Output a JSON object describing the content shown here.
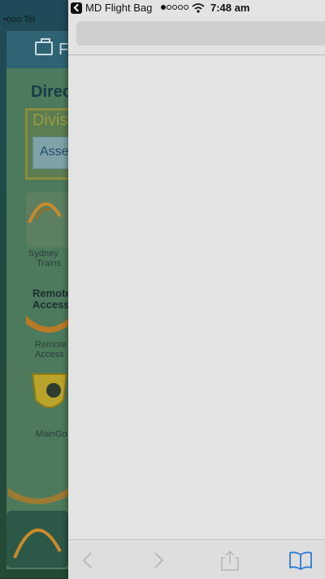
{
  "background_app": {
    "status_carrier": "•ooo Tel",
    "header_text": "F",
    "panel_title": "Direc",
    "division_label": "Divis",
    "division_button": "Asse",
    "tiles": [
      {
        "label_line1": "Sydney",
        "label_line2": "Trains"
      },
      {
        "label_line1": "Remote",
        "label_line2": "Access"
      },
      {
        "label_line1": "MainGo",
        "label_line2": ""
      }
    ],
    "section_label_line1": "Remote",
    "section_label_line2": "Access"
  },
  "status_bar": {
    "back_app_label": "MD Flight Bag",
    "signal_strength": 1,
    "signal_total": 5,
    "time": "7:48 am"
  },
  "browser": {
    "address_value": "",
    "toolbar": [
      "back-icon",
      "forward-icon",
      "share-icon",
      "bookmarks-icon"
    ]
  },
  "colors": {
    "browser_bg": "#e3e3e3",
    "toolbar_icon": "#2f7ad4",
    "toolbar_icon_disabled": "#b9b9b9"
  }
}
